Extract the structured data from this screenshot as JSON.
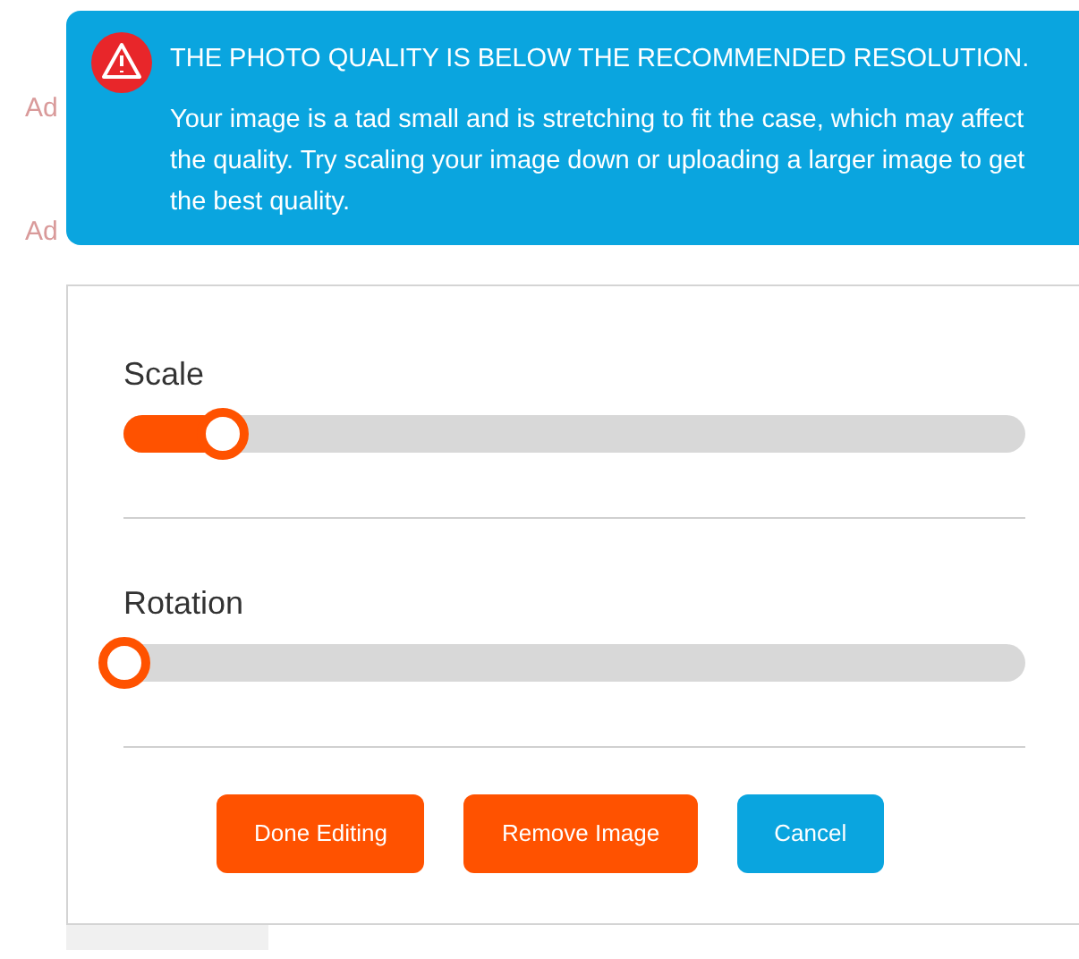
{
  "background_labels": [
    "Ad",
    "Ad"
  ],
  "alert": {
    "title": "THE PHOTO QUALITY IS BELOW THE RECOMMENDED RESOLUTION.",
    "message": "Your image is a tad small and is stretching to fit the case, which may affect the quality. Try scaling your image down or uploading a larger image to get the best quality."
  },
  "sliders": [
    {
      "label": "Scale",
      "level": 0.11
    },
    {
      "label": "Rotation",
      "level": 0
    }
  ],
  "buttons": [
    {
      "label": "Done Editing",
      "kind": "primary"
    },
    {
      "label": "Remove Image",
      "kind": "primary"
    },
    {
      "label": "Cancel",
      "kind": "secondary"
    }
  ]
}
